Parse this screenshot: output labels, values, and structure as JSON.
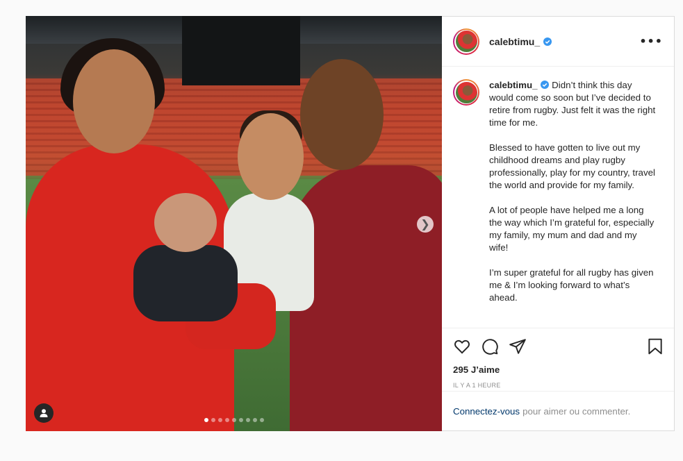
{
  "post": {
    "username": "calebtimu_",
    "more_icon": "more-options-icon",
    "caption_paragraphs": [
      "Didn’t think this day would come so soon but I’ve decided to retire from rugby. Just felt it was the right time for me.",
      "Blessed to have gotten to live out my childhood dreams and play rugby professionally, play for my country, travel the world and provide for my family.",
      "A lot of people have helped me a long the way which I’m grateful for, especially my family, my mum and dad and my wife!",
      "I’m super grateful for all rugby has given me & I’m looking forward to what’s ahead."
    ],
    "likes": "295 J’aime",
    "time": "IL Y A 1 HEURE",
    "login_link": "Connectez-vous",
    "login_rest": "pour aimer ou commenter.",
    "carousel": {
      "count": 9,
      "active_index": 0
    }
  },
  "colors": {
    "verified": "#3897f0",
    "link": "#00376b",
    "muted": "#8e8e8e"
  }
}
